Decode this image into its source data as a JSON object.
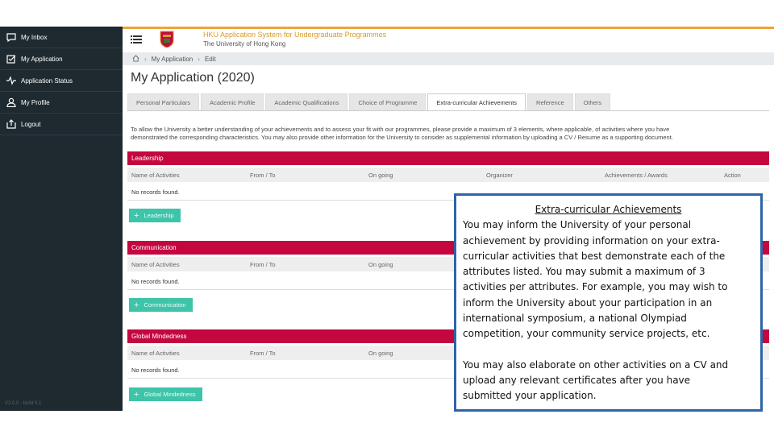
{
  "sidebar": {
    "items": [
      {
        "label": "My Inbox",
        "icon": "inbox-icon"
      },
      {
        "label": "My Application",
        "icon": "checkbox-icon"
      },
      {
        "label": "Application Status",
        "icon": "pulse-icon"
      },
      {
        "label": "My Profile",
        "icon": "user-icon"
      },
      {
        "label": "Logout",
        "icon": "logout-icon"
      }
    ],
    "version": "V2.0.0 - build 5.1"
  },
  "header": {
    "title": "HKU Application System for Undergraduate Programmes",
    "subtitle": "The University of Hong Kong"
  },
  "breadcrumb": {
    "items": [
      "My Application",
      "Edit"
    ]
  },
  "page": {
    "title": "My Application (2020)"
  },
  "tabs": [
    {
      "label": "Personal Particulars",
      "active": false
    },
    {
      "label": "Academic Profile",
      "active": false
    },
    {
      "label": "Academic Qualifications",
      "active": false
    },
    {
      "label": "Choice of Programme",
      "active": false
    },
    {
      "label": "Extra-curricular Achievements",
      "active": true
    },
    {
      "label": "Reference",
      "active": false
    },
    {
      "label": "Others",
      "active": false
    }
  ],
  "intro": {
    "line1": "To allow the University a better understanding of your achievements and to assess your fit with our programmes, please provide a maximum of 3 elements, where applicable, of activities where you have",
    "line2": "demonstrated the corresponding characteristics. You may also provide other information for the University to consider as supplemental information by uploading a CV / Resume as a supporting document."
  },
  "columns": [
    "Name of Activities",
    "From / To",
    "On going",
    "Organizer",
    "Achievements / Awards",
    "Action"
  ],
  "sections": [
    {
      "title": "Leadership",
      "empty": "No records found.",
      "button": "Leadership",
      "columns": [
        "Name of Activities",
        "From / To",
        "On going",
        "Organizer",
        "Achievements / Awards",
        "Action"
      ]
    },
    {
      "title": "Communication",
      "empty": "No records found.",
      "button": "Communication",
      "columns": [
        "Name of Activities",
        "From / To",
        "On going"
      ]
    },
    {
      "title": "Global Mindedness",
      "empty": "No records found.",
      "button": "Global Mindedness",
      "columns": [
        "Name of Activities",
        "From / To",
        "On going"
      ]
    }
  ],
  "callout": {
    "title": "Extra-curricular Achievements",
    "lines1": [
      "You may inform the University of your personal",
      "achievement by providing information on your extra-",
      "curricular activities that best demonstrate each of the",
      "attributes listed. You may submit a maximum of 3",
      "activities per attributes. For example, you may wish to",
      "inform the University about your participation in an",
      "international symposium, a national Olympiad",
      "competition, your community service projects, etc."
    ],
    "lines2": [
      "You may also elaborate on other activities on a CV and",
      "upload any relevant certificates after you have",
      "submitted your application."
    ]
  },
  "colors": {
    "sidebar": "#1f2a30",
    "accent": "#c4073f",
    "button": "#3ec4a9",
    "callout_border": "#2f64a8",
    "header_accent": "#f0a33a"
  }
}
